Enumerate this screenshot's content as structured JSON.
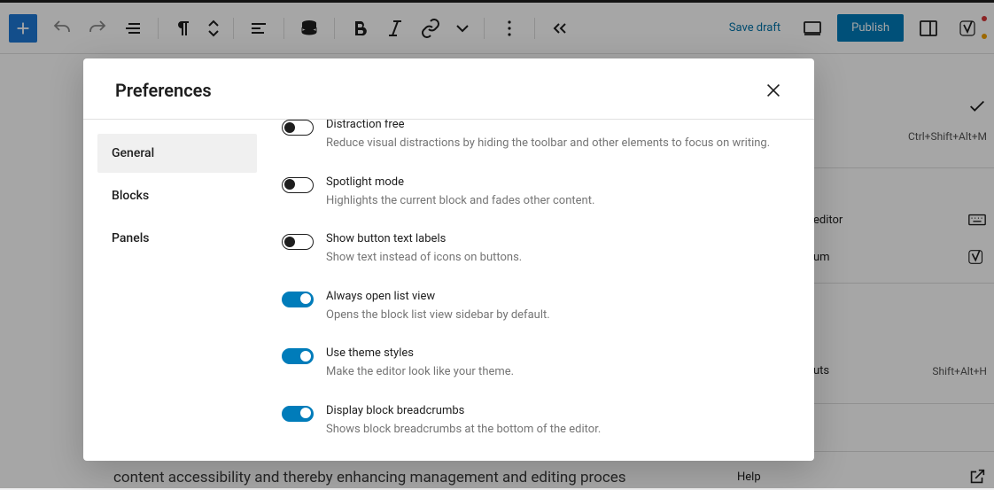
{
  "toolbar": {
    "save_draft": "Save draft",
    "publish": "Publish"
  },
  "modal": {
    "title": "Preferences",
    "tabs": {
      "general": "General",
      "blocks": "Blocks",
      "panels": "Panels"
    },
    "prefs": [
      {
        "label": "Distraction free",
        "desc": "Reduce visual distractions by hiding the toolbar and other elements to focus on writing.",
        "on": false
      },
      {
        "label": "Spotlight mode",
        "desc": "Highlights the current block and fades other content.",
        "on": false
      },
      {
        "label": "Show button text labels",
        "desc": "Show text instead of icons on buttons.",
        "on": false
      },
      {
        "label": "Always open list view",
        "desc": "Opens the block list view sidebar by default.",
        "on": true
      },
      {
        "label": "Use theme styles",
        "desc": "Make the editor look like your theme.",
        "on": true
      },
      {
        "label": "Display block breadcrumbs",
        "desc": "Shows block breadcrumbs at the bottom of the editor.",
        "on": true
      }
    ]
  },
  "bg": {
    "text_line": "content accessibility and thereby enhancing management and editing proces",
    "help": "Help",
    "shortcut1": "Ctrl+Shift+Alt+M",
    "editor_text": "editor",
    "um_text": "um",
    "uts_text": "uts",
    "shortcut2": "Shift+Alt+H"
  }
}
